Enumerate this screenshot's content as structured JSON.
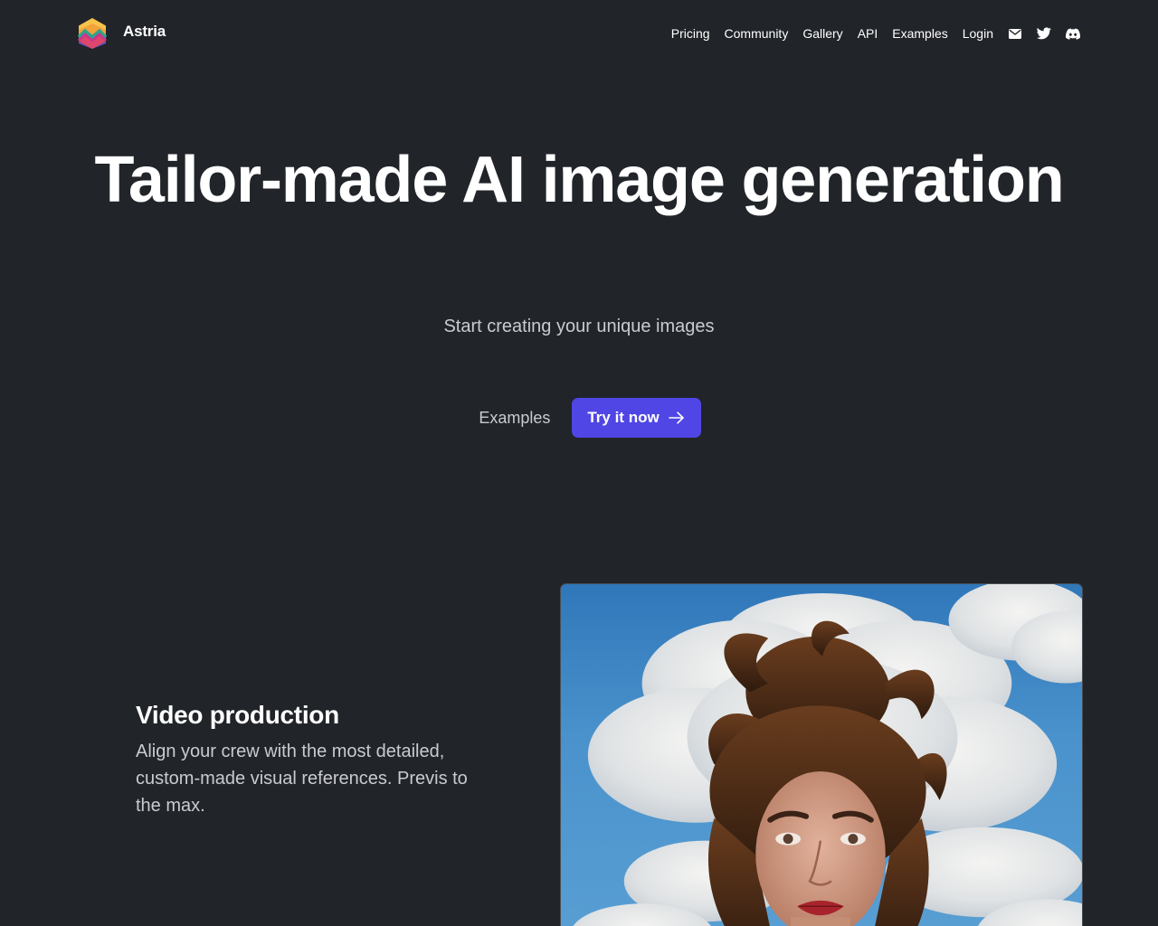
{
  "header": {
    "brand_name": "Astria",
    "nav": [
      {
        "label": "Pricing"
      },
      {
        "label": "Community"
      },
      {
        "label": "Gallery"
      },
      {
        "label": "API"
      },
      {
        "label": "Examples"
      },
      {
        "label": "Login"
      }
    ],
    "icons": [
      "mail-icon",
      "twitter-icon",
      "discord-icon"
    ]
  },
  "hero": {
    "title": "Tailor-made AI image generation",
    "subtitle": "Start creating your unique images",
    "secondary_button": "Examples",
    "primary_button": "Try it now"
  },
  "feature": {
    "title": "Video production",
    "description": "Align your crew with the most detailed, custom-made visual references. Previs to the max."
  },
  "colors": {
    "background": "#212429",
    "accent": "#5046e5",
    "muted_text": "#c9cbcf"
  }
}
